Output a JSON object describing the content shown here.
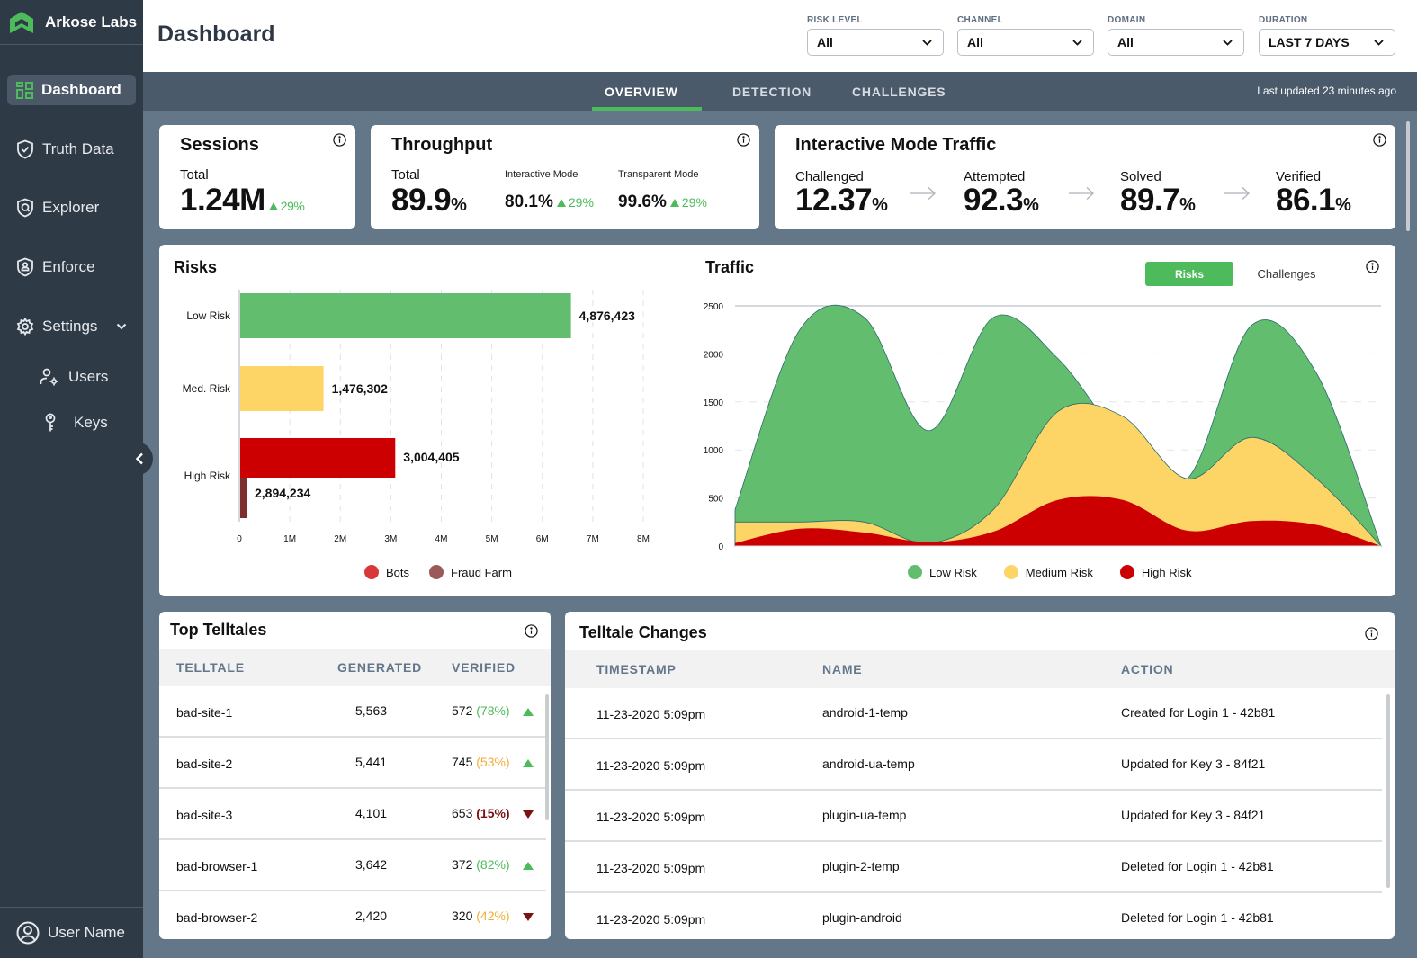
{
  "brand": {
    "name": "Arkose Labs",
    "color": "#4dbb5b"
  },
  "sidebar": {
    "items": [
      {
        "label": "Dashboard",
        "icon": "grid-icon",
        "active": true
      },
      {
        "label": "Truth Data",
        "icon": "shield-check-icon"
      },
      {
        "label": "Explorer",
        "icon": "shield-search-icon"
      },
      {
        "label": "Enforce",
        "icon": "shield-user-icon"
      },
      {
        "label": "Settings",
        "icon": "gear-icon",
        "expanded": true
      }
    ],
    "sub_items": [
      {
        "label": "Users",
        "icon": "user-gear-icon"
      },
      {
        "label": "Keys",
        "icon": "key-icon"
      }
    ],
    "user": {
      "label": "User Name",
      "icon": "user-circle-icon"
    }
  },
  "header": {
    "title": "Dashboard",
    "filters": [
      {
        "label": "RISK LEVEL",
        "value": "All"
      },
      {
        "label": "CHANNEL",
        "value": "All"
      },
      {
        "label": "DOMAIN",
        "value": "All"
      },
      {
        "label": "DURATION",
        "value": "LAST 7 DAYS"
      }
    ]
  },
  "tabs": {
    "items": [
      {
        "label": "OVERVIEW",
        "active": true
      },
      {
        "label": "DETECTION"
      },
      {
        "label": "CHALLENGES"
      }
    ],
    "last_updated": "Last updated 23 minutes ago"
  },
  "sessions": {
    "title": "Sessions",
    "total_label": "Total",
    "total_value": "1.24M",
    "delta": "29%"
  },
  "throughput": {
    "title": "Throughput",
    "total_label": "Total",
    "total_value": "89.9",
    "total_unit": "%",
    "interactive_label": "Interactive Mode",
    "interactive_value": "80.1%",
    "interactive_delta": "29%",
    "transparent_label": "Transparent Mode",
    "transparent_value": "99.6%",
    "transparent_delta": "29%"
  },
  "interactive_traffic": {
    "title": "Interactive Mode Traffic",
    "steps": [
      {
        "label": "Challenged",
        "value": "12.37",
        "unit": "%"
      },
      {
        "label": "Attempted",
        "value": "92.3",
        "unit": "%"
      },
      {
        "label": "Solved",
        "value": "89.7",
        "unit": "%"
      },
      {
        "label": "Verified",
        "value": "86.1",
        "unit": "%"
      }
    ]
  },
  "colors": {
    "low": "#62be6e",
    "medium": "#fdd466",
    "high": "#cc0000",
    "fraud": "#7d2f2f",
    "bots_legend": "#d9383a",
    "fraud_legend": "#9a5a5a",
    "up": "#4dbb5b",
    "down": "#7a1414"
  },
  "chart_data": [
    {
      "type": "bar",
      "orientation": "horizontal",
      "title": "Risks",
      "categories": [
        "Low Risk",
        "Med. Risk",
        "High Risk"
      ],
      "bars": [
        {
          "category": "Low Risk",
          "value": 6550000,
          "label": "4,876,423",
          "series": "low"
        },
        {
          "category": "Med. Risk",
          "value": 1650000,
          "label": "1,476,302",
          "series": "medium"
        },
        {
          "category": "High Risk",
          "value": 3070000,
          "label": "3,004,405",
          "series": "Bots"
        },
        {
          "category": "High Risk",
          "value": 150000,
          "label": "2,894,234",
          "series": "Fraud Farm"
        }
      ],
      "xticks": [
        "0",
        "1M",
        "2M",
        "3M",
        "4M",
        "5M",
        "6M",
        "7M",
        "8M"
      ],
      "xlim": [
        0,
        8000000
      ],
      "grid": true,
      "legend": [
        "Bots",
        "Fraud Farm"
      ],
      "legend_position": "bottom"
    },
    {
      "type": "area",
      "title": "Traffic",
      "toggle": {
        "active": "Risks",
        "inactive": "Challenges"
      },
      "ylim": [
        0,
        2500
      ],
      "yticks": [
        "0",
        "500",
        "1000",
        "1500",
        "2000",
        "2500"
      ],
      "x": [
        0,
        1,
        2,
        3,
        4,
        5,
        6,
        7,
        8,
        9,
        10
      ],
      "series": [
        {
          "name": "Low Risk",
          "values": [
            380,
            2250,
            2380,
            1200,
            2380,
            1950,
            1100,
            700,
            2300,
            1800,
            0
          ]
        },
        {
          "name": "Medium Risk",
          "values": [
            250,
            250,
            250,
            30,
            380,
            1400,
            1350,
            700,
            1130,
            700,
            0
          ]
        },
        {
          "name": "High Risk",
          "values": [
            30,
            180,
            140,
            40,
            150,
            480,
            480,
            160,
            260,
            220,
            0
          ]
        }
      ],
      "grid": true,
      "legend_position": "bottom"
    }
  ],
  "top_telltales": {
    "title": "Top Telltales",
    "columns": [
      "TELLTALE",
      "GENERATED",
      "VERIFIED"
    ],
    "rows": [
      {
        "name": "bad-site-1",
        "generated": "5,563",
        "verified": "572",
        "pct": "(78%)",
        "pct_color": "green",
        "trend": "up"
      },
      {
        "name": "bad-site-2",
        "generated": "5,441",
        "verified": "745",
        "pct": "(53%)",
        "pct_color": "orange",
        "trend": "up"
      },
      {
        "name": "bad-site-3",
        "generated": "4,101",
        "verified": "653",
        "pct": "(15%)",
        "pct_color": "red",
        "trend": "down"
      },
      {
        "name": "bad-browser-1",
        "generated": "3,642",
        "verified": "372",
        "pct": "(82%)",
        "pct_color": "green",
        "trend": "up"
      },
      {
        "name": "bad-browser-2",
        "generated": "2,420",
        "verified": "320",
        "pct": "(42%)",
        "pct_color": "orange",
        "trend": "down"
      }
    ]
  },
  "telltale_changes": {
    "title": "Telltale Changes",
    "columns": [
      "TIMESTAMP",
      "NAME",
      "ACTION"
    ],
    "rows": [
      {
        "timestamp": "11-23-2020 5:09pm",
        "name": "android-1-temp",
        "action": "Created for Login 1 - 42b81"
      },
      {
        "timestamp": "11-23-2020 5:09pm",
        "name": "android-ua-temp",
        "action": "Updated for Key 3 - 84f21"
      },
      {
        "timestamp": "11-23-2020 5:09pm",
        "name": "plugin-ua-temp",
        "action": "Updated for Key 3 - 84f21"
      },
      {
        "timestamp": "11-23-2020 5:09pm",
        "name": "plugin-2-temp",
        "action": "Deleted for Login 1 - 42b81"
      },
      {
        "timestamp": "11-23-2020 5:09pm",
        "name": "plugin-android",
        "action": "Deleted for Login 1 - 42b81"
      }
    ]
  }
}
